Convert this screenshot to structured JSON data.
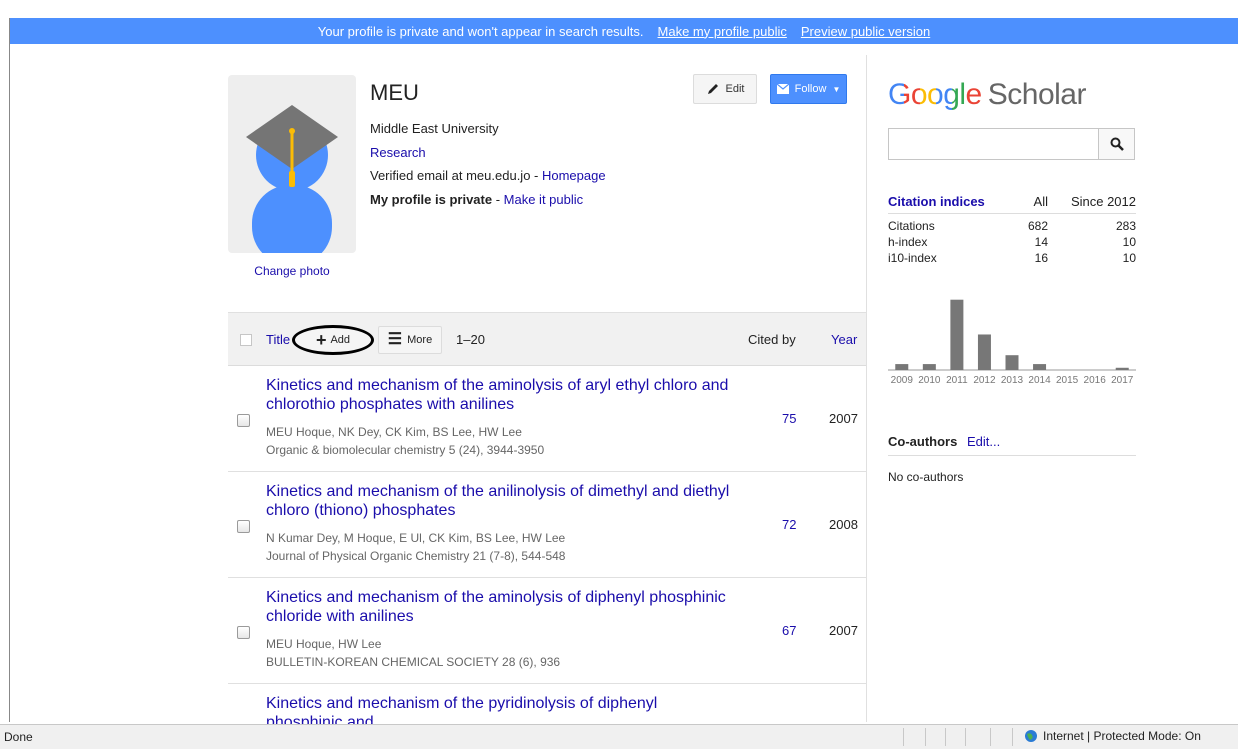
{
  "banner": {
    "message": "Your profile is private and won't appear in search results.",
    "make_public": "Make my profile public",
    "preview": "Preview public version"
  },
  "profile": {
    "name": "MEU",
    "affiliation": "Middle East University",
    "interest": "Research",
    "email_prefix": "Verified email at meu.edu.jo - ",
    "homepage": "Homepage",
    "private_bold": "My profile is private",
    "private_sep": " - ",
    "make_it_public": "Make it public",
    "change_photo": "Change photo",
    "edit_label": "Edit",
    "follow_label": "Follow"
  },
  "table": {
    "title_header": "Title",
    "add_label": "Add",
    "more_label": "More",
    "range": "1–20",
    "cited_by": "Cited by",
    "year": "Year",
    "rows": [
      {
        "title": "Kinetics and mechanism of the aminolysis of aryl ethyl chloro and chlorothio phosphates with anilines",
        "authors": "MEU Hoque, NK Dey, CK Kim, BS Lee, HW Lee",
        "pub": "Organic & biomolecular chemistry 5 (24), 3944-3950",
        "cited": "75",
        "year": "2007"
      },
      {
        "title": "Kinetics and mechanism of the anilinolysis of dimethyl and diethyl chloro (thiono) phosphates",
        "authors": "N Kumar Dey, M Hoque, E Ul, CK Kim, BS Lee, HW Lee",
        "pub": "Journal of Physical Organic Chemistry 21 (7‐8), 544-548",
        "cited": "72",
        "year": "2008"
      },
      {
        "title": "Kinetics and mechanism of the aminolysis of diphenyl phosphinic chloride with anilines",
        "authors": "MEU Hoque, HW Lee",
        "pub": "BULLETIN-KOREAN CHEMICAL SOCIETY 28 (6), 936",
        "cited": "67",
        "year": "2007"
      },
      {
        "title": "Kinetics and mechanism of the pyridinolysis of diphenyl phosphinic and",
        "authors": "",
        "pub": "",
        "cited": "",
        "year": ""
      }
    ]
  },
  "scholar": {
    "logo_google": "Google",
    "logo_scholar": "Scholar",
    "search_value": ""
  },
  "citations": {
    "header": [
      "Citation indices",
      "All",
      "Since 2012"
    ],
    "rows": [
      [
        "Citations",
        "682",
        "283"
      ],
      [
        "h-index",
        "14",
        "10"
      ],
      [
        "i10-index",
        "16",
        "10"
      ]
    ]
  },
  "chart_data": {
    "type": "bar",
    "categories": [
      "2009",
      "2010",
      "2011",
      "2012",
      "2013",
      "2014",
      "2015",
      "2016",
      "2017"
    ],
    "values": [
      8,
      8,
      95,
      48,
      20,
      8,
      0,
      0,
      3
    ],
    "ylim": [
      0,
      100
    ],
    "bar_color": "#777777"
  },
  "coauthors": {
    "title": "Co-authors",
    "edit": "Edit...",
    "none": "No co-authors"
  },
  "statusbar": {
    "left": "Done",
    "zone": "Internet | Protected Mode: On"
  },
  "colors": {
    "banner": "#4d90fe",
    "link": "#1a0dab"
  }
}
